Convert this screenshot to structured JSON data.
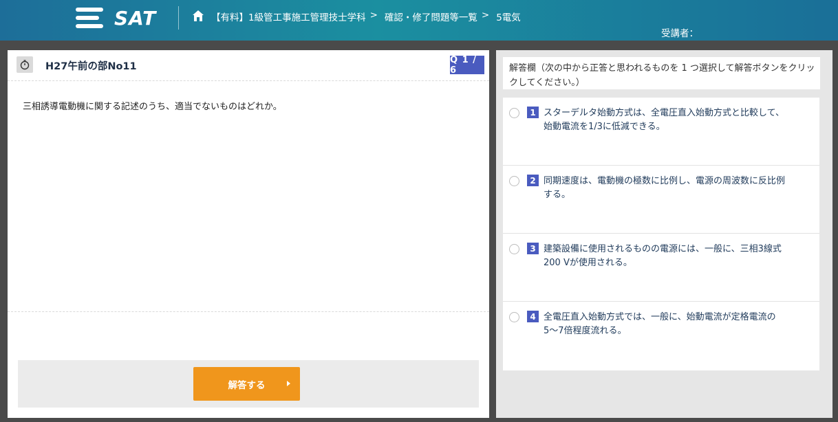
{
  "header": {
    "logo_text": "SAT",
    "breadcrumb": [
      {
        "label": "【有料】1級管工事施工管理技士学科"
      },
      {
        "label": "確認・修了問題等一覧"
      },
      {
        "label": "5電気"
      }
    ],
    "separator": ">",
    "user_label": "受講者："
  },
  "question": {
    "title": "H27午前の部No11",
    "badge": "Q 1 / 6",
    "text": "三相誘導電動機に関する記述のうち、適当でないものはどれか。",
    "answer_button": "解答する"
  },
  "answer_panel": {
    "instruction": "解答欄（次の中から正答と思われるものを 1 つ選択して解答ボタンをクリックしてください。）",
    "options": [
      {
        "num": "1",
        "text": "スターデルタ始動方式は、全電圧直入始動方式と比較して、始動電流を1/3に低減できる。"
      },
      {
        "num": "2",
        "text": "同期速度は、電動機の極数に比例し、電源の周波数に反比例する。"
      },
      {
        "num": "3",
        "text": "建築設備に使用されるものの電源には、一般に、三相3線式200 Vが使用される。"
      },
      {
        "num": "4",
        "text": "全電圧直入始動方式では、一般に、始動電流が定格電流の5〜7倍程度流れる。"
      }
    ]
  },
  "colors": {
    "accent": "#4a5bbf",
    "button": "#f0961c",
    "header_start": "#1d6e99",
    "header_mid": "#1b8fa0"
  },
  "icons": [
    "home-icon",
    "stopwatch-icon",
    "play-arrow-icon",
    "logo-lines-icon"
  ]
}
